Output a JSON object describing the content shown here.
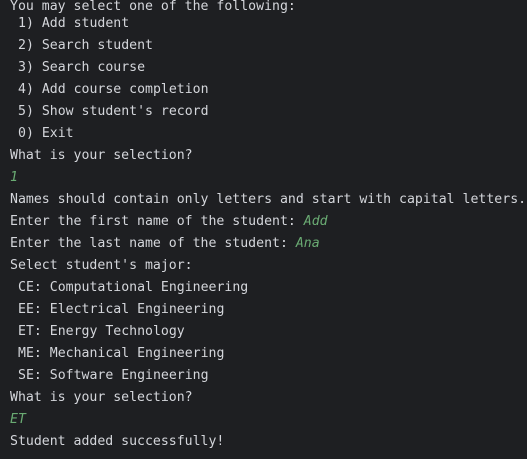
{
  "menu": {
    "prompt": "You may select one of the following:",
    "options": [
      "1) Add student",
      "2) Search student",
      "3) Search course",
      "4) Add course completion",
      "5) Show student's record",
      "0) Exit"
    ],
    "question": "What is your selection?",
    "input": "1"
  },
  "names_rule": "Names should contain only letters and start with capital letters.",
  "first_name": {
    "prompt": "Enter the first name of the student: ",
    "input": "Add"
  },
  "last_name": {
    "prompt": "Enter the last name of the student: ",
    "input": "Ana"
  },
  "major": {
    "prompt": "Select student's major:",
    "options": [
      "CE: Computational Engineering",
      "EE: Electrical Engineering",
      "ET: Energy Technology",
      "ME: Mechanical Engineering",
      "SE: Software Engineering"
    ],
    "question": "What is your selection?",
    "input": "ET"
  },
  "result": "Student added successfully!",
  "colors": {
    "background": "#1e1f22",
    "text": "#d4d6db",
    "user_input": "#6aab73"
  }
}
